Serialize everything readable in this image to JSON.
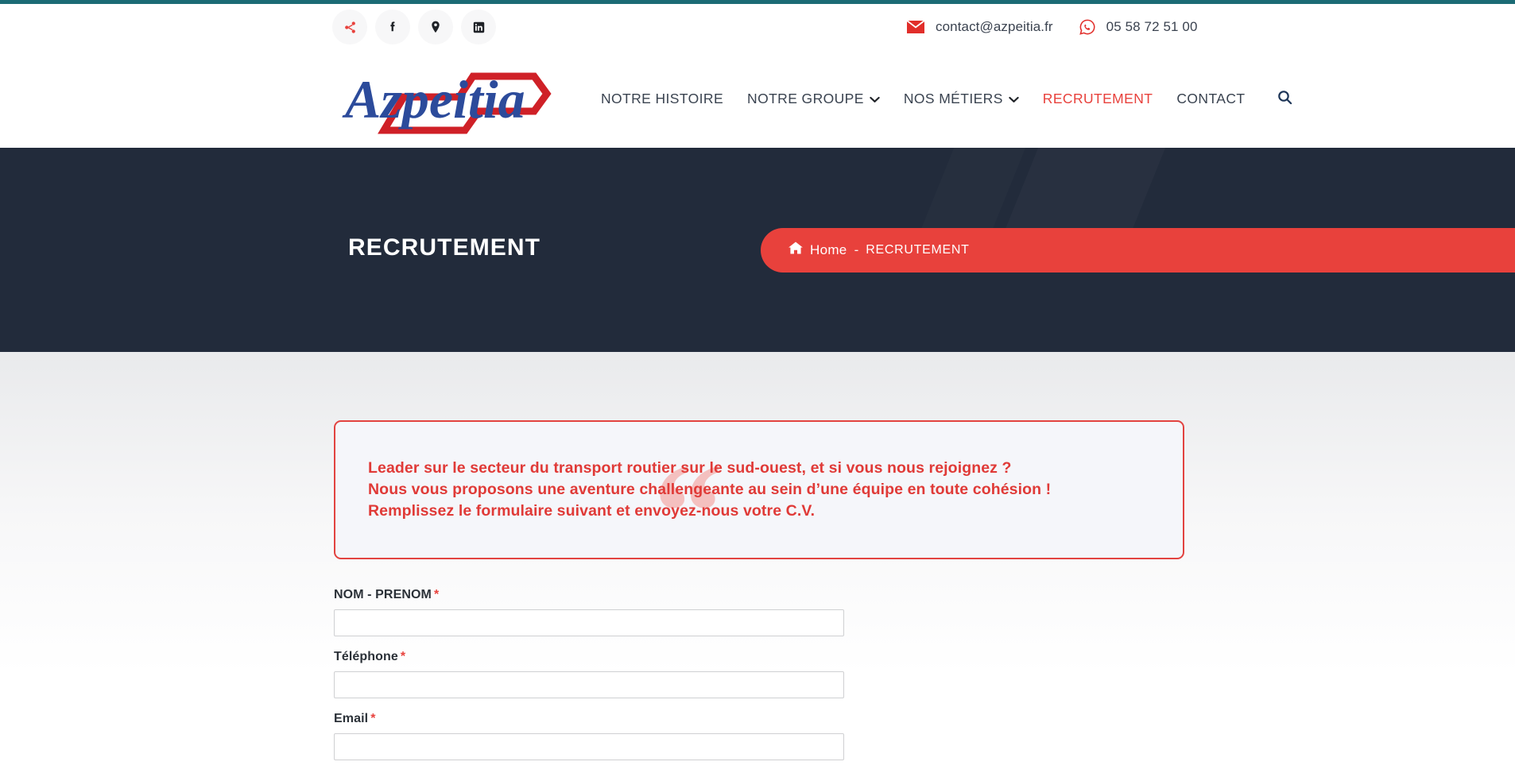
{
  "topbar": {
    "social": [
      {
        "name": "share-icon",
        "label": "Partager"
      },
      {
        "name": "facebook-icon",
        "label": "Facebook"
      },
      {
        "name": "map-pin-icon",
        "label": "Localisation"
      },
      {
        "name": "linkedin-icon",
        "label": "LinkedIn"
      }
    ],
    "email": "contact@azpeitia.fr",
    "phone": "05 58 72 51 00"
  },
  "header": {
    "logo_text": "Azpeitia",
    "nav": [
      {
        "label": "NOTRE HISTOIRE",
        "has_dropdown": false,
        "active": false
      },
      {
        "label": "NOTRE GROUPE",
        "has_dropdown": true,
        "active": false
      },
      {
        "label": "NOS MÉTIERS",
        "has_dropdown": true,
        "active": false
      },
      {
        "label": "RECRUTEMENT",
        "has_dropdown": false,
        "active": true
      },
      {
        "label": "CONTACT",
        "has_dropdown": false,
        "active": false
      }
    ],
    "search_label": "Rechercher"
  },
  "hero": {
    "title": "RECRUTEMENT",
    "breadcrumb": {
      "home": "Home",
      "separator": "-",
      "current": "RECRUTEMENT"
    }
  },
  "main": {
    "quote": {
      "line1": "Leader sur le secteur du transport routier sur le sud-ouest, et si vous nous rejoignez ?",
      "line2": "Nous vous proposons une aventure challengeante au sein d’une équipe en toute cohésion !",
      "line3": "Remplissez le formulaire suivant et envoyez-nous votre C.V.",
      "watermark": "“"
    },
    "form": {
      "fields": [
        {
          "label": "NOM - PRENOM",
          "required_mark": "*",
          "value": "",
          "placeholder": ""
        },
        {
          "label": "Téléphone",
          "required_mark": "*",
          "value": "",
          "placeholder": ""
        },
        {
          "label": "Email",
          "required_mark": "*",
          "value": "",
          "placeholder": ""
        }
      ]
    }
  },
  "colors": {
    "accent_red": "#e8413c",
    "hero_navy": "#222b3b",
    "logo_blue": "#2c4b9b",
    "logo_red": "#cf2027",
    "browser_edge_teal": "#1b6b75"
  }
}
